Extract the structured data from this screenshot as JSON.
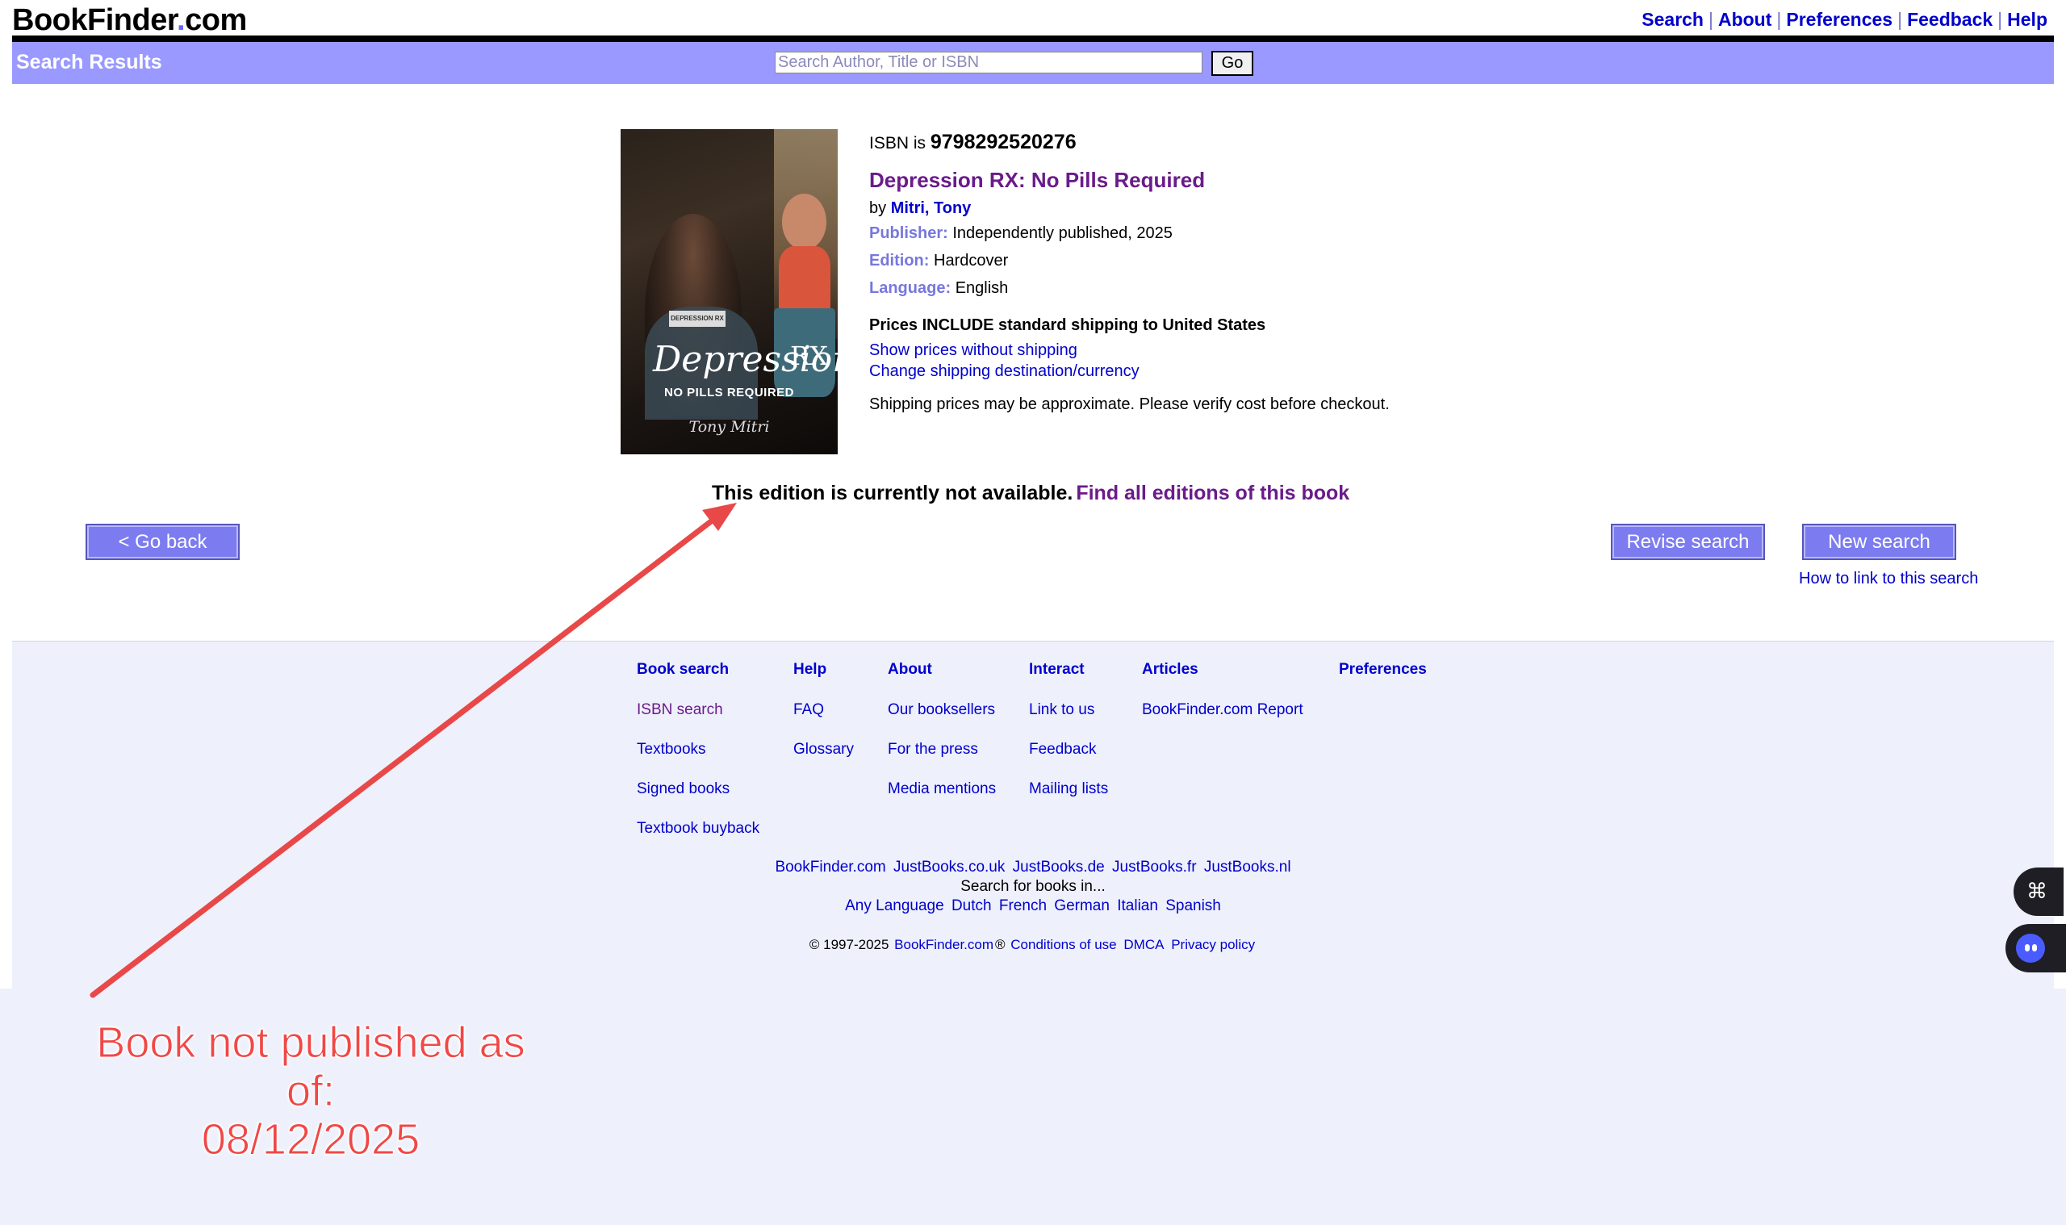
{
  "header": {
    "logo_main": "BookFinder",
    "logo_dot": ".",
    "logo_tld": "com",
    "nav": [
      "Search",
      "About",
      "Preferences",
      "Feedback",
      "Help"
    ],
    "nav_sep": "|"
  },
  "search": {
    "title": "Search Results",
    "placeholder": "Search Author, Title or ISBN",
    "go_label": "Go"
  },
  "book": {
    "cover": {
      "badge": "DEPRESSION RX",
      "title": "Depression",
      "rx": "RX",
      "subtitle": "NO PILLS REQUIRED",
      "author": "Tony Mitri"
    },
    "isbn_prefix": "ISBN is ",
    "isbn": "9798292520276",
    "title": "Depression RX: No Pills Required",
    "by_prefix": "by ",
    "author": "Mitri, Tony",
    "publisher_label": "Publisher:",
    "publisher": "Independently published, 2025",
    "edition_label": "Edition:",
    "edition": "Hardcover",
    "language_label": "Language:",
    "language": "English",
    "shipping_heading": "Prices INCLUDE standard shipping to United States",
    "shipping_link1": "Show prices without shipping",
    "shipping_link2": "Change shipping destination/currency",
    "shipping_note": "Shipping prices may be approximate. Please verify cost before checkout."
  },
  "availability": {
    "message": "This edition is currently not available.",
    "link": "Find all editions of this book"
  },
  "actions": {
    "go_back": "< Go back",
    "revise": "Revise search",
    "new_search": "New search",
    "link_search": "How to link to this search"
  },
  "footer": {
    "columns": [
      {
        "heading": "Book search",
        "links": [
          "ISBN search",
          "Textbooks",
          "Signed books",
          "Textbook buyback"
        ]
      },
      {
        "heading": "Help",
        "links": [
          "FAQ",
          "Glossary"
        ]
      },
      {
        "heading": "About",
        "links": [
          "Our booksellers",
          "For the press",
          "Media mentions"
        ]
      },
      {
        "heading": "Interact",
        "links": [
          "Link to us",
          "Feedback",
          "Mailing lists"
        ]
      },
      {
        "heading": "Articles",
        "links": [
          "BookFinder.com Report"
        ]
      },
      {
        "heading": "Preferences",
        "links": []
      }
    ],
    "sites": [
      "BookFinder.com",
      "JustBooks.co.uk",
      "JustBooks.de",
      "JustBooks.fr",
      "JustBooks.nl"
    ],
    "search_in": "Search for books in...",
    "languages": [
      "Any Language",
      "Dutch",
      "French",
      "German",
      "Italian",
      "Spanish"
    ],
    "copyright": "© 1997-2025",
    "copyright_site": "BookFinder.com",
    "copyright_reg": "®",
    "legal": [
      "Conditions of use",
      "DMCA",
      "Privacy policy"
    ]
  },
  "widgets": {
    "widget1_icon": "grid-icon",
    "widget2_icon": "assistant-face-icon"
  },
  "annotation": {
    "line1": "Book not published as",
    "line2": "of:",
    "line3": "08/12/2025",
    "color": "#f04848"
  },
  "colors": {
    "accent": "#9999ff",
    "link": "#0000cc",
    "visited": "#6a1b8a",
    "label": "#7777dd",
    "button": "#7c7cf0"
  }
}
